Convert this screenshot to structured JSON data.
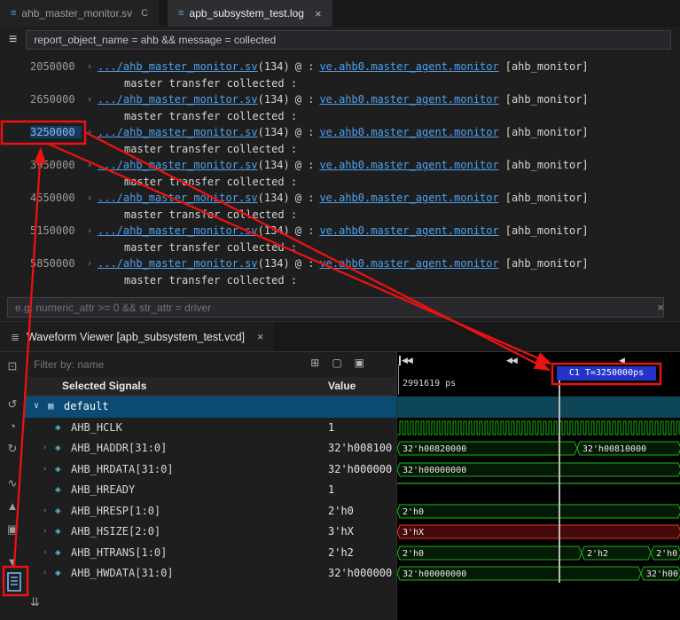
{
  "editor_tabs": {
    "tabs": [
      {
        "icon": "≡",
        "label": "ahb_master_monitor.sv",
        "badge": "C"
      },
      {
        "icon": "≡",
        "label": "apb_subsystem_test.log",
        "close": "×"
      }
    ]
  },
  "filter_bar": {
    "menu_icon": "≡",
    "query": "report_object_name = ahb && message = collected"
  },
  "log": {
    "expander": "›",
    "file_link": ".../ahb_master_monitor.sv",
    "line_ref": "(134)",
    "separator": "@ :",
    "scope_link": "ve.ahb0.master_agent.monitor",
    "tag": "[ahb_monitor]",
    "message": "master transfer collected :",
    "times": [
      "2050000",
      "2650000",
      "3250000",
      "3950000",
      "4550000",
      "5150000",
      "5850000"
    ],
    "highlighted_time": "3250000"
  },
  "attr_filter": {
    "placeholder": "e.g. numeric_attr >= 0 && str_attr = driver",
    "clear_icon": "×"
  },
  "panel": {
    "tab_icon": "≣",
    "tab_label": "Waveform Viewer [apb_subsystem_test.vcd]",
    "close_icon": "×"
  },
  "left_toolbar": {
    "icons": [
      {
        "name": "save-view-icon",
        "glyph": "⊡"
      },
      {
        "name": "refresh-icon",
        "glyph": "↺"
      },
      {
        "name": "history-icon",
        "glyph": "◔"
      },
      {
        "name": "sync-icon",
        "glyph": "↻"
      },
      {
        "name": "analog-wave-icon",
        "glyph": "∿"
      },
      {
        "name": "scroll-up-icon",
        "glyph": "▲"
      },
      {
        "name": "grid-view-icon",
        "glyph": "▣"
      },
      {
        "name": "scroll-down-icon",
        "glyph": "▼"
      }
    ],
    "scroll_top_icon": "↥",
    "scroll_bottom_icon": "⇊"
  },
  "waveform": {
    "filter_placeholder": "Filter by: name",
    "toolbar_icons": [
      {
        "name": "add-group-icon",
        "glyph": "⊞"
      },
      {
        "name": "copy-signals-icon",
        "glyph": "▢"
      },
      {
        "name": "duplicate-signals-icon",
        "glyph": "▣"
      }
    ],
    "header": {
      "signals": "Selected Signals",
      "value": "Value"
    },
    "group_chevron": "∨",
    "group_icon": "▦",
    "group_label": "default",
    "signal_expander": "›",
    "signal_icon": "◈",
    "signals": [
      {
        "name": "AHB_HCLK",
        "value": "1",
        "expandable": false
      },
      {
        "name": "AHB_HADDR[31:0]",
        "value": "32'h008100",
        "expandable": true
      },
      {
        "name": "AHB_HRDATA[31:0]",
        "value": "32'h000000",
        "expandable": true
      },
      {
        "name": "AHB_HREADY",
        "value": "1",
        "expandable": false
      },
      {
        "name": "AHB_HRESP[1:0]",
        "value": "2'h0",
        "expandable": true
      },
      {
        "name": "AHB_HSIZE[2:0]",
        "value": "3'hX",
        "expandable": true
      },
      {
        "name": "AHB_HTRANS[1:0]",
        "value": "2'h2",
        "expandable": true
      },
      {
        "name": "AHB_HWDATA[31:0]",
        "value": "32'h000000",
        "expandable": true
      }
    ],
    "ruler": {
      "start_label": "2991619 ps",
      "cursor_label": "C1 T=3250000ps",
      "markers": [
        "◀◀",
        "◀◀",
        "◀"
      ]
    },
    "waves": [
      {
        "signal": "AHB_HCLK",
        "type": "clock"
      },
      {
        "signal": "AHB_HADDR",
        "type": "bus",
        "segments": [
          {
            "label": "32'h00820000",
            "w": 0.634
          },
          {
            "label": "32'h00810000",
            "w": 0.366
          }
        ]
      },
      {
        "signal": "AHB_HRDATA",
        "type": "bus",
        "segments": [
          {
            "label": "32'h00000000",
            "w": 1
          }
        ]
      },
      {
        "signal": "AHB_HREADY",
        "type": "level_high"
      },
      {
        "signal": "AHB_HRESP",
        "type": "bus",
        "segments": [
          {
            "label": "2'h0",
            "w": 1
          }
        ]
      },
      {
        "signal": "AHB_HSIZE",
        "type": "bus_error",
        "segments": [
          {
            "label": "3'hX",
            "w": 1
          }
        ]
      },
      {
        "signal": "AHB_HTRANS",
        "type": "bus",
        "segments": [
          {
            "label": "2'h0",
            "w": 0.65
          },
          {
            "label": "2'h2",
            "w": 0.244
          },
          {
            "label": "2'h0",
            "w": 0.106
          }
        ]
      },
      {
        "signal": "AHB_HWDATA",
        "type": "bus",
        "segments": [
          {
            "label": "32'h00000000",
            "w": 0.859
          },
          {
            "label": "32'h00",
            "w": 0.141
          }
        ]
      }
    ],
    "colors": {
      "trace": "#17b517",
      "error": "#e03434",
      "cursor_label_bg": "#2433c8",
      "group_band": "#0d4656",
      "annotation": "#ea1212"
    }
  }
}
